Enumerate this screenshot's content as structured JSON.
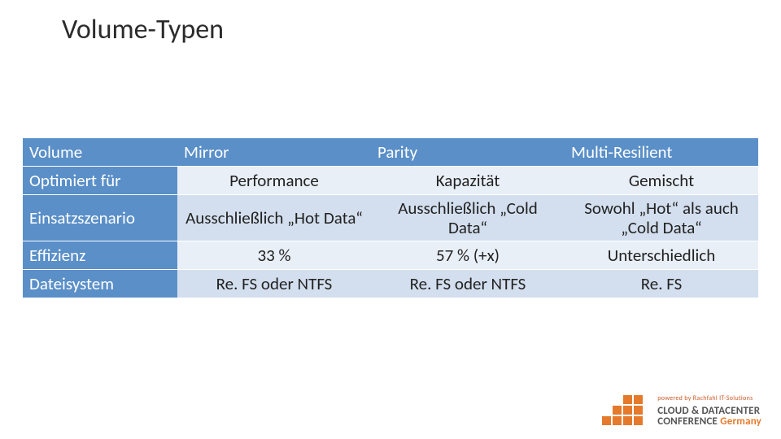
{
  "title": "Volume-Typen",
  "chart_data": {
    "type": "table",
    "columns": [
      "Volume",
      "Mirror",
      "Parity",
      "Multi-Resilient"
    ],
    "rows": [
      {
        "label": "Optimiert für",
        "values": [
          "Performance",
          "Kapazität",
          "Gemischt"
        ]
      },
      {
        "label": "Einsatzszenario",
        "values": [
          "Ausschließlich „Hot Data“",
          "Ausschließlich „Cold Data“",
          "Sowohl „Hot“ als auch „Cold Data“"
        ]
      },
      {
        "label": "Effizienz",
        "values": [
          "33 %",
          "57 % (+x)",
          "Unterschiedlich"
        ]
      },
      {
        "label": "Dateisystem",
        "values": [
          "Re. FS oder NTFS",
          "Re. FS oder NTFS",
          "Re. FS"
        ]
      }
    ]
  },
  "footer": {
    "powered": "powered by Rachfahl IT-Solutions",
    "line1": "CLOUD & DATACENTER",
    "line2a": "CONFERENCE ",
    "line2b": "Germany"
  }
}
